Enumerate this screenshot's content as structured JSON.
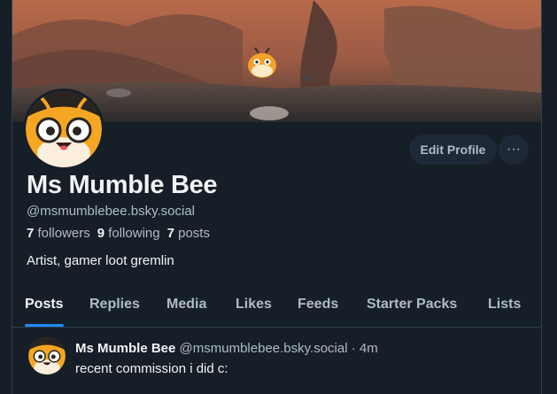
{
  "profile": {
    "display_name": "Ms Mumble Bee",
    "handle": "@msmumblebee.bsky.social",
    "followers_count": "7",
    "followers_label": "followers",
    "following_count": "9",
    "following_label": "following",
    "posts_count": "7",
    "posts_label": "posts",
    "bio": "Artist, gamer loot gremlin"
  },
  "actions": {
    "edit_profile_label": "Edit Profile",
    "more_label": "···"
  },
  "tabs": [
    {
      "label": "Posts",
      "active": true
    },
    {
      "label": "Replies",
      "active": false
    },
    {
      "label": "Media",
      "active": false
    },
    {
      "label": "Likes",
      "active": false
    },
    {
      "label": "Feeds",
      "active": false
    },
    {
      "label": "Starter Packs",
      "active": false
    },
    {
      "label": "Lists",
      "active": false
    }
  ],
  "post": {
    "author_name": "Ms Mumble Bee",
    "author_handle": "@msmumblebee.bsky.social",
    "separator": "·",
    "time": "4m",
    "text": "recent commission i did c:"
  },
  "colors": {
    "background": "#161e27",
    "accent": "#208bfe",
    "text_primary": "#f1f3f5",
    "text_secondary": "#aebbc9"
  }
}
